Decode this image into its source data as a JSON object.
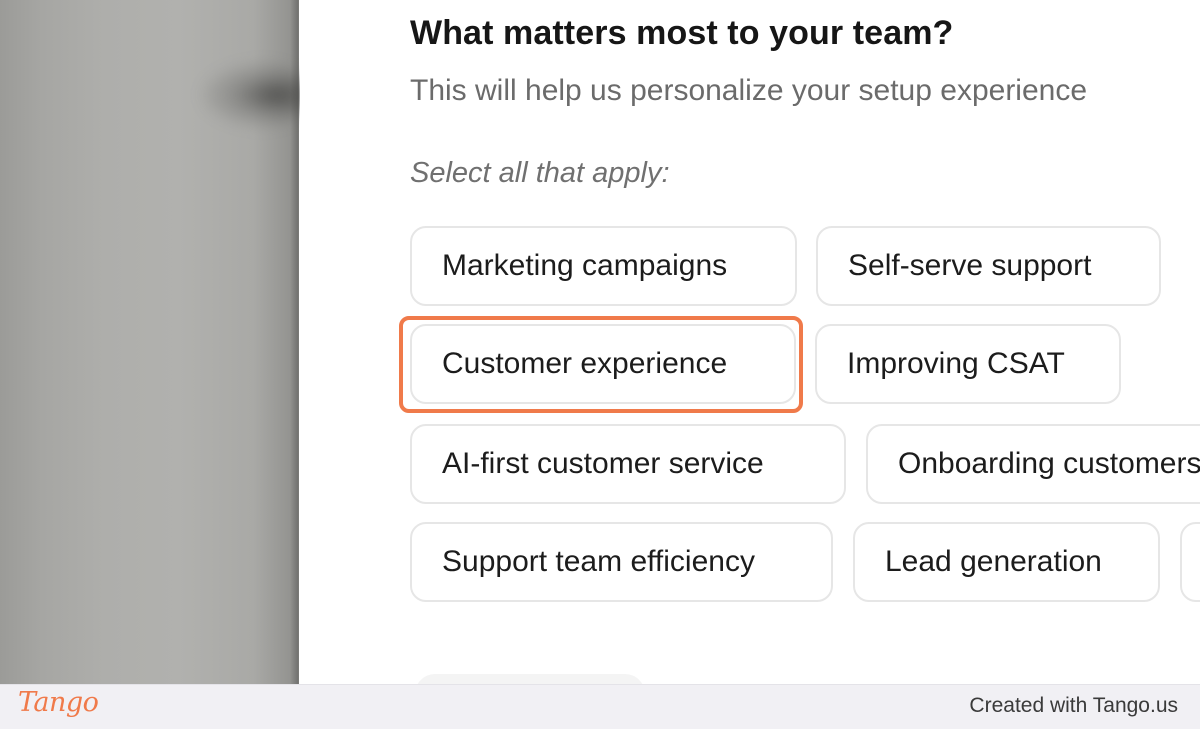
{
  "question": {
    "title": "What matters most to your team?",
    "subtitle": "This will help us personalize your setup experience",
    "instruction": "Select all that apply:"
  },
  "options": [
    "Marketing campaigns",
    "Self-serve support",
    "Customer experience",
    "Improving CSAT",
    "AI-first customer service",
    "Onboarding customers",
    "Support team efficiency",
    "Lead generation"
  ],
  "highlighted_option": "Customer experience",
  "footer": {
    "logo": "Tango",
    "credit": "Created with Tango.us"
  },
  "colors": {
    "accent": "#f07a4a",
    "chip_border": "#e6e6e6",
    "footer_bg": "#f1f0f4"
  }
}
